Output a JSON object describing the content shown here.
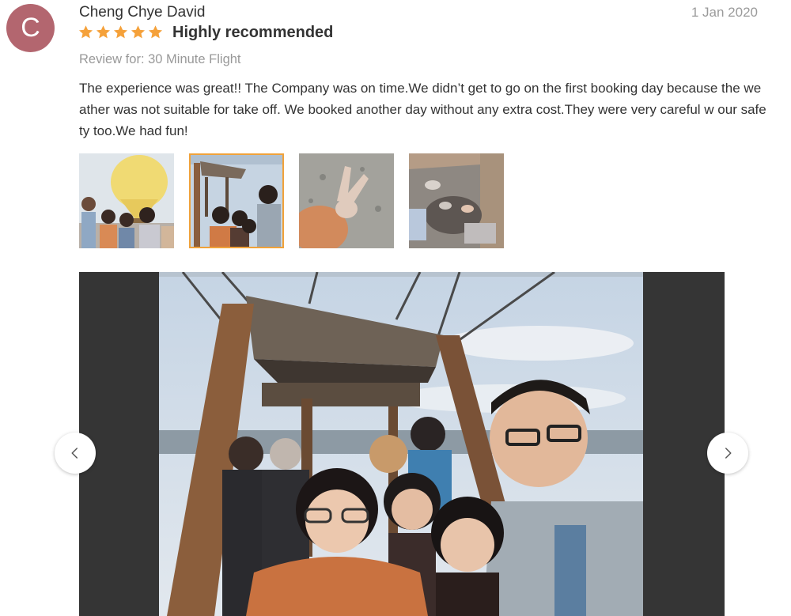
{
  "review": {
    "avatar_letter": "C",
    "reviewer_name": "Cheng Chye David",
    "date": "1 Jan 2020",
    "rating": 5,
    "headline": "Highly recommended",
    "review_for": "Review for: 30 Minute Flight",
    "body": "The experience was great!! The Company was on time.We didn’t get to go on the first booking day because the weather was not suitable for take off. We booked another day without any extra cost.They were very careful w our safety too.We had fun!"
  },
  "colors": {
    "avatar": "#b3666f",
    "star": "#f5a13a",
    "selected_border": "#f0a23a",
    "viewer_bg": "#353535"
  },
  "gallery": {
    "selected_index": 1,
    "thumbnails": [
      {
        "name": "balloon-group-photo"
      },
      {
        "name": "basket-selfie-photo"
      },
      {
        "name": "peace-sign-landscape-photo"
      },
      {
        "name": "feet-in-basket-photo"
      }
    ],
    "icons": {
      "prev": "chevron-left-icon",
      "next": "chevron-right-icon"
    }
  }
}
